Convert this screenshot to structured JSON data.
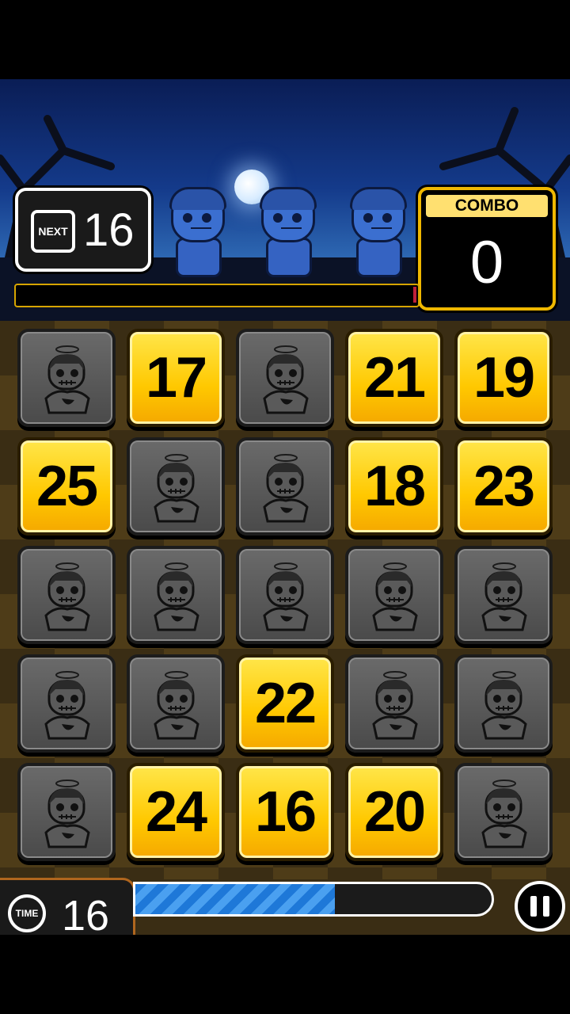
{
  "hud": {
    "next_label": "NEXT",
    "next_value": "16",
    "combo_label": "COMBO",
    "combo_value": "0",
    "time_label": "TIME",
    "time_value": "16",
    "time_progress": 0.56
  },
  "board": {
    "rows": [
      [
        null,
        "17",
        null,
        "21",
        "19"
      ],
      [
        "25",
        null,
        null,
        "18",
        "23"
      ],
      [
        null,
        null,
        null,
        null,
        null
      ],
      [
        null,
        null,
        "22",
        null,
        null
      ],
      [
        null,
        "24",
        "16",
        "20",
        null
      ]
    ]
  },
  "colors": {
    "tile_yellow": "#ffc800",
    "tile_dark": "#4a4a4a",
    "time_bar": "#1e78d8",
    "combo_border": "#f0b800"
  },
  "icons": {
    "pause": "pause-icon",
    "time": "time-icon",
    "next": "next-icon",
    "locked_tile": "zombie-icon"
  }
}
